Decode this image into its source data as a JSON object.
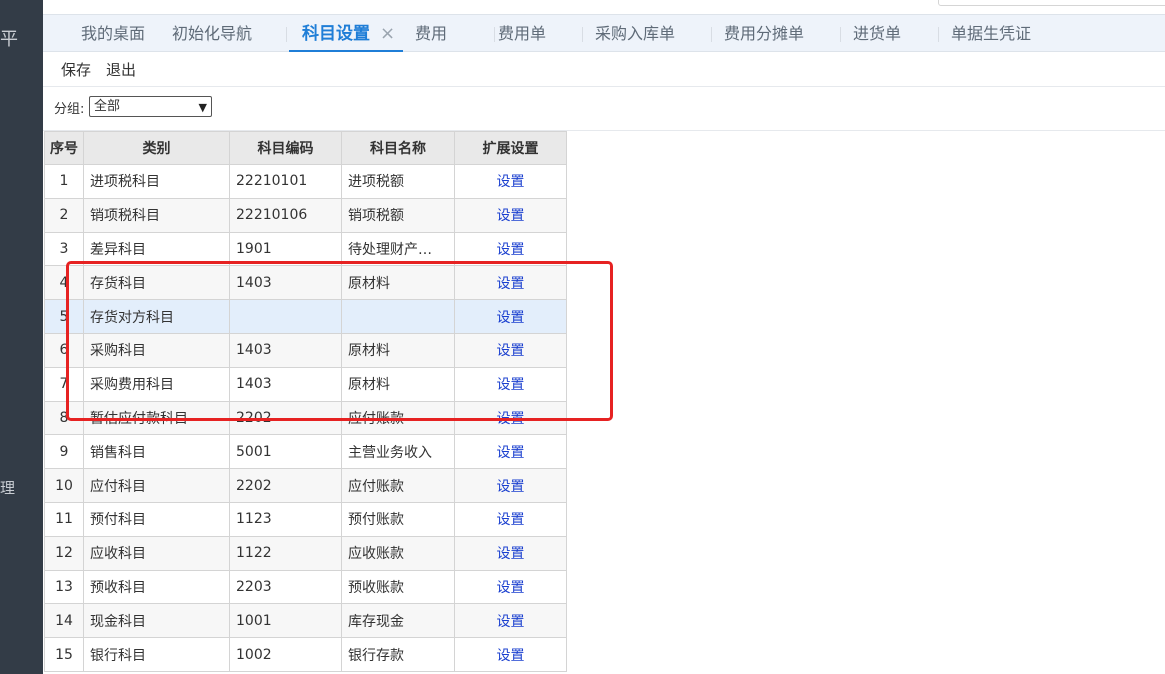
{
  "sidebar": {
    "fragment_top": "平",
    "fragment_bottom": "理"
  },
  "tabs": [
    {
      "label": "我的桌面"
    },
    {
      "label": "初始化导航"
    },
    {
      "label": "科目设置",
      "close": "×"
    },
    {
      "label": "费用"
    },
    {
      "label": "费用单"
    },
    {
      "label": "采购入库单"
    },
    {
      "label": "费用分摊单"
    },
    {
      "label": "进货单"
    },
    {
      "label": "单据生凭证"
    }
  ],
  "toolbar": {
    "save": "保存",
    "exit": "退出"
  },
  "filter": {
    "label": "分组:",
    "value": "全部"
  },
  "table": {
    "headers": [
      "序号",
      "类别",
      "科目编码",
      "科目名称",
      "扩展设置"
    ],
    "rows": [
      {
        "idx": "1",
        "type": "进项税科目",
        "code": "22210101",
        "name": "进项税额",
        "action": "设置"
      },
      {
        "idx": "2",
        "type": "销项税科目",
        "code": "22210106",
        "name": "销项税额",
        "action": "设置"
      },
      {
        "idx": "3",
        "type": "差异科目",
        "code": "1901",
        "name": "待处理财产…",
        "action": "设置"
      },
      {
        "idx": "4",
        "type": "存货科目",
        "code": "1403",
        "name": "原材料",
        "action": "设置"
      },
      {
        "idx": "5",
        "type": "存货对方科目",
        "code": "",
        "name": "",
        "action": "设置"
      },
      {
        "idx": "6",
        "type": "采购科目",
        "code": "1403",
        "name": "原材料",
        "action": "设置"
      },
      {
        "idx": "7",
        "type": "采购费用科目",
        "code": "1403",
        "name": "原材料",
        "action": "设置"
      },
      {
        "idx": "8",
        "type": "暂估应付款科目",
        "code": "2202",
        "name": "应付账款",
        "action": "设置"
      },
      {
        "idx": "9",
        "type": "销售科目",
        "code": "5001",
        "name": "主营业务收入",
        "action": "设置"
      },
      {
        "idx": "10",
        "type": "应付科目",
        "code": "2202",
        "name": "应付账款",
        "action": "设置"
      },
      {
        "idx": "11",
        "type": "预付科目",
        "code": "1123",
        "name": "预付账款",
        "action": "设置"
      },
      {
        "idx": "12",
        "type": "应收科目",
        "code": "1122",
        "name": "应收账款",
        "action": "设置"
      },
      {
        "idx": "13",
        "type": "预收科目",
        "code": "2203",
        "name": "预收账款",
        "action": "设置"
      },
      {
        "idx": "14",
        "type": "现金科目",
        "code": "1001",
        "name": "库存现金",
        "action": "设置"
      },
      {
        "idx": "15",
        "type": "银行科目",
        "code": "1002",
        "name": "银行存款",
        "action": "设置"
      }
    ]
  },
  "colors": {
    "accent": "#1f7ed7",
    "link": "#1a3fcf",
    "highlight_box": "#e62222",
    "sidebar": "#333c47"
  }
}
